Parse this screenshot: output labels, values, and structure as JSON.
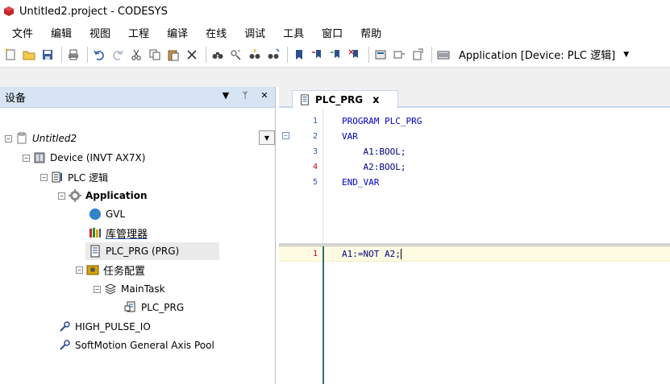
{
  "window": {
    "title": "Untitled2.project - CODESYS"
  },
  "menu": {
    "items": [
      {
        "label": "文件"
      },
      {
        "label": "编辑"
      },
      {
        "label": "视图"
      },
      {
        "label": "工程"
      },
      {
        "label": "编译"
      },
      {
        "label": "在线"
      },
      {
        "label": "调试"
      },
      {
        "label": "工具"
      },
      {
        "label": "窗口"
      },
      {
        "label": "帮助"
      }
    ]
  },
  "toolbar": {
    "active_application": "Application [Device: PLC 逻辑]"
  },
  "devices_panel": {
    "title": "设备",
    "pin_glyph": "ᛘ",
    "close_glyph": "✕",
    "menu_glyph": "▼",
    "tree": [
      {
        "label": "Untitled2",
        "icon": "project-icon"
      },
      {
        "label": "Device (INVT AX7X)",
        "icon": "device-icon"
      },
      {
        "label": "PLC 逻辑",
        "icon": "plc-logic-icon"
      },
      {
        "label": "Application",
        "icon": "application-gear-icon"
      },
      {
        "label": "GVL",
        "icon": "globe-icon"
      },
      {
        "label": "库管理器",
        "icon": "library-manager-icon"
      },
      {
        "label": "PLC_PRG (PRG)",
        "icon": "pou-icon"
      },
      {
        "label": "任务配置",
        "icon": "task-config-icon"
      },
      {
        "label": "MainTask",
        "icon": "task-icon"
      },
      {
        "label": "PLC_PRG",
        "icon": "program-call-icon"
      },
      {
        "label": "HIGH_PULSE_IO",
        "icon": "io-icon"
      },
      {
        "label": "SoftMotion General Axis Pool",
        "icon": "axis-pool-icon"
      }
    ]
  },
  "editor": {
    "tab_label": "PLC_PRG",
    "tab_close": "x",
    "declaration": {
      "lines": [
        {
          "no": "1",
          "text": "PROGRAM PLC_PRG"
        },
        {
          "no": "2",
          "text": "VAR"
        },
        {
          "no": "3",
          "text": "    A1:BOOL;"
        },
        {
          "no": "4",
          "text": "    A2:BOOL;"
        },
        {
          "no": "5",
          "text": "END_VAR"
        }
      ]
    },
    "implementation": {
      "lines": [
        {
          "no": "1",
          "text": "A1:=NOT A2;"
        }
      ]
    }
  }
}
